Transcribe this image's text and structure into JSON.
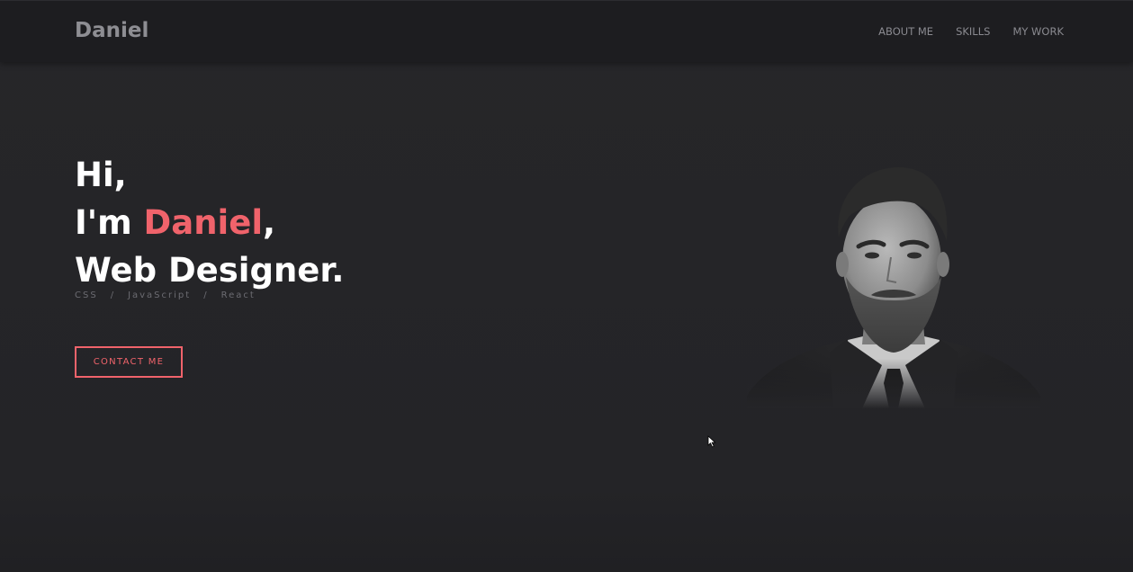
{
  "nav": {
    "brand": "Daniel",
    "links": [
      "ABOUT ME",
      "SKILLS",
      "MY WORK"
    ]
  },
  "hero": {
    "line1": "Hi,",
    "line2_prefix": "I'm ",
    "line2_name": "Daniel",
    "line2_suffix": ",",
    "line3": "Web Designer.",
    "skills": [
      "CSS",
      "/",
      "JavaScript",
      "/",
      "React"
    ],
    "cta_label": "CONTACT ME"
  },
  "colors": {
    "accent": "#f0636b",
    "background": "#252528",
    "navbar": "#1d1d20"
  },
  "icons": {
    "cursor": "mouse-pointer-icon"
  }
}
